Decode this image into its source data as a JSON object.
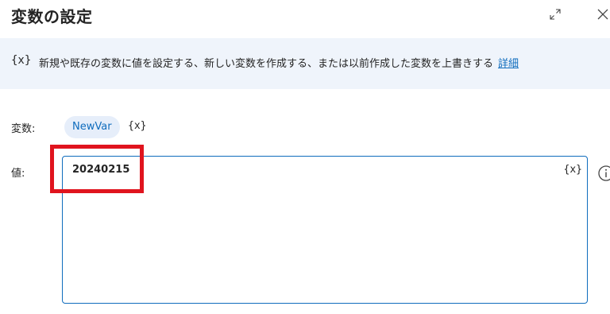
{
  "dialog": {
    "title": "変数の設定",
    "expand_icon": "expand-icon",
    "close_icon": "close-icon"
  },
  "banner": {
    "icon": "{x}",
    "text": "新規や既存の変数に値を設定する、新しい変数を作成する、または以前作成した変数を上書きする",
    "link": "詳細"
  },
  "fields": {
    "variable_label": "変数:",
    "variable_name": "NewVar",
    "variable_picker": "{x}",
    "value_label": "値:",
    "value": "20240215",
    "value_insert": "{x}",
    "info_icon": "info-icon"
  },
  "colors": {
    "accent": "#0f6cbd",
    "banner_bg": "#eff4fb",
    "highlight": "#e0141e"
  }
}
